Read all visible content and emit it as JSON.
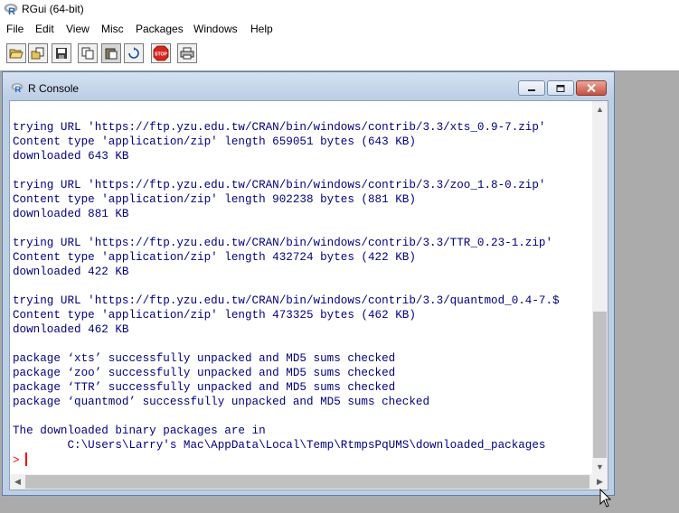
{
  "app": {
    "title": "RGui (64-bit)"
  },
  "menu": [
    {
      "label": "File"
    },
    {
      "label": "Edit"
    },
    {
      "label": "View"
    },
    {
      "label": "Misc"
    },
    {
      "label": "Packages"
    },
    {
      "label": "Windows"
    },
    {
      "label": "Help"
    }
  ],
  "toolbar": {
    "buttons": [
      {
        "icon": "open-script-icon"
      },
      {
        "icon": "load-workspace-icon"
      },
      {
        "icon": "save-workspace-icon"
      },
      {
        "icon": "copy-icon"
      },
      {
        "icon": "paste-icon"
      },
      {
        "icon": "copy-paste-icon"
      },
      {
        "icon": "stop-icon",
        "text": "STOP"
      },
      {
        "icon": "print-icon"
      }
    ]
  },
  "console": {
    "title": "R Console",
    "lines": [
      "trying URL 'https://ftp.yzu.edu.tw/CRAN/bin/windows/contrib/3.3/xts_0.9-7.zip'",
      "Content type 'application/zip' length 659051 bytes (643 KB)",
      "downloaded 643 KB",
      "",
      "trying URL 'https://ftp.yzu.edu.tw/CRAN/bin/windows/contrib/3.3/zoo_1.8-0.zip'",
      "Content type 'application/zip' length 902238 bytes (881 KB)",
      "downloaded 881 KB",
      "",
      "trying URL 'https://ftp.yzu.edu.tw/CRAN/bin/windows/contrib/3.3/TTR_0.23-1.zip'",
      "Content type 'application/zip' length 432724 bytes (422 KB)",
      "downloaded 422 KB",
      "",
      "trying URL 'https://ftp.yzu.edu.tw/CRAN/bin/windows/contrib/3.3/quantmod_0.4-7.$",
      "Content type 'application/zip' length 473325 bytes (462 KB)",
      "downloaded 462 KB",
      "",
      "package ‘xts’ successfully unpacked and MD5 sums checked",
      "package ‘zoo’ successfully unpacked and MD5 sums checked",
      "package ‘TTR’ successfully unpacked and MD5 sums checked",
      "package ‘quantmod’ successfully unpacked and MD5 sums checked",
      "",
      "The downloaded binary packages are in",
      "        C:\\Users\\Larry's Mac\\AppData\\Local\\Temp\\RtmpsPqUMS\\downloaded_packages"
    ],
    "prompt": ">",
    "output_color": "#000080",
    "prompt_color": "#ff0000"
  }
}
